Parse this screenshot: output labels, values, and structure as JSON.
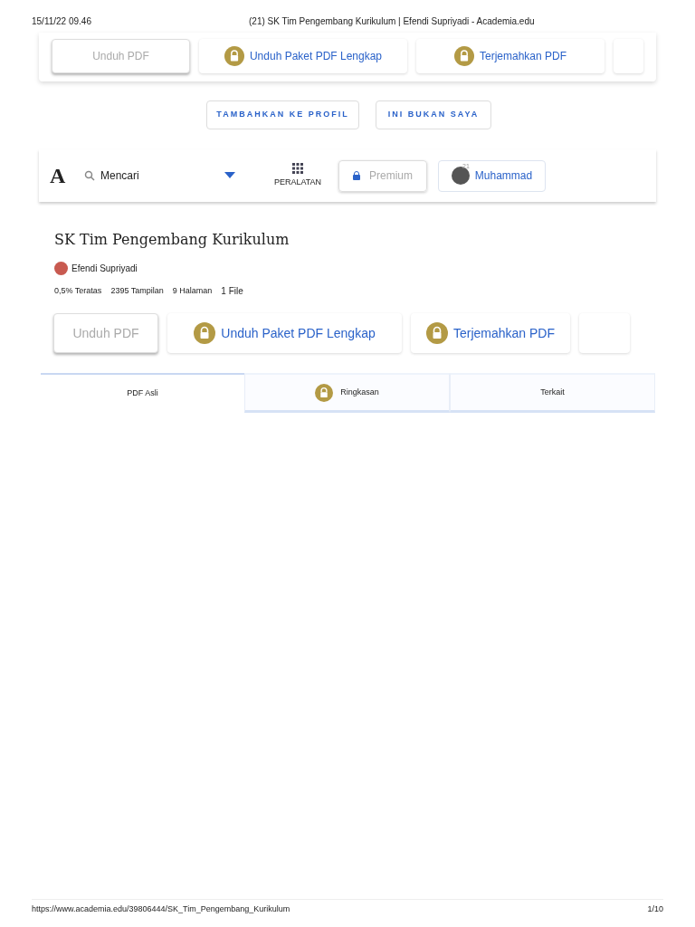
{
  "print_header": {
    "date": "15/11/22 09.46",
    "title": "(21) SK Tim Pengembang Kurikulum | Efendi Supriyadi - Academia.edu"
  },
  "top_bar": {
    "buttons": [
      {
        "label": "Unduh PDF",
        "locked": false,
        "kind": "primary"
      },
      {
        "label": "Unduh Paket PDF Lengkap",
        "locked": true,
        "kind": "secondary"
      },
      {
        "label": "Terjemahkan PDF",
        "locked": true,
        "kind": "secondary"
      },
      {
        "kind": "stub"
      }
    ]
  },
  "profile_actions": [
    "TAMBAHKAN KE PROFIL",
    "INI BUKAN SAYA"
  ],
  "nav": {
    "logo": "A",
    "search_placeholder": "Mencari",
    "tools_label": "PERALATAN",
    "premium_label": "Premium",
    "user_name": "Muhammad",
    "notification_count": "21"
  },
  "document": {
    "title": "SK Tim Pengembang Kurikulum",
    "author": "Efendi Supriyadi",
    "stats": [
      "0,5% Teratas",
      "2395 Tampilan",
      "9 Halaman",
      "1 File"
    ],
    "buttons": [
      {
        "label": "Unduh PDF",
        "locked": false,
        "kind": "primary"
      },
      {
        "label": "Unduh Paket PDF Lengkap",
        "locked": true,
        "kind": "secondary"
      },
      {
        "label": "Terjemahkan PDF",
        "locked": true,
        "kind": "secondary"
      },
      {
        "kind": "stub"
      }
    ]
  },
  "tabs": [
    {
      "label": "PDF Asli",
      "selected": true,
      "locked": false
    },
    {
      "label": "Ringkasan",
      "selected": false,
      "locked": true
    },
    {
      "label": "Terkait",
      "selected": false,
      "locked": false
    }
  ],
  "print_footer": {
    "url": "https://www.academia.edu/39806444/SK_Tim_Pengembang_Kurikulum",
    "page": "1/10"
  }
}
